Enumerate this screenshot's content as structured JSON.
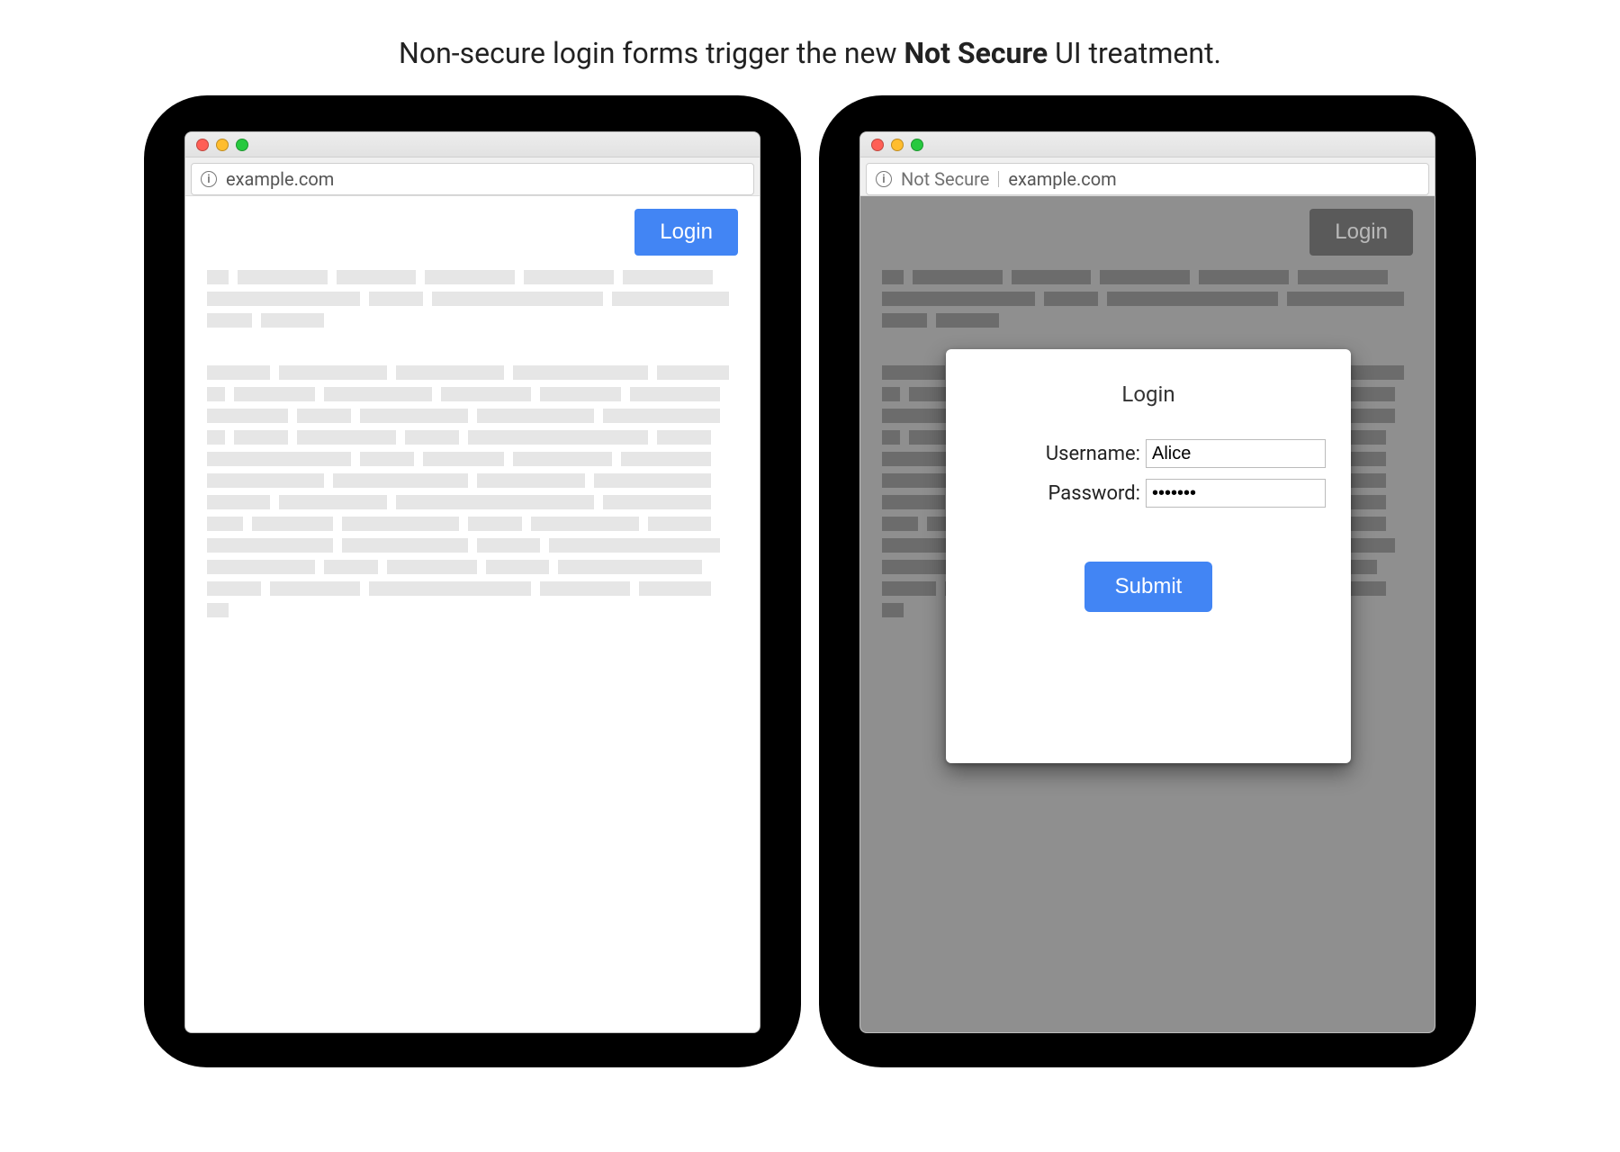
{
  "caption": {
    "prefix": "Non-secure login forms trigger the new ",
    "bold": "Not Secure",
    "suffix": " UI treatment."
  },
  "left_browser": {
    "address": "example.com",
    "login_button": "Login"
  },
  "right_browser": {
    "not_secure_label": "Not Secure",
    "address": "example.com",
    "login_button": "Login",
    "modal": {
      "title": "Login",
      "username_label": "Username:",
      "username_value": "Alice",
      "password_label": "Password:",
      "password_value": "•••••••",
      "submit_label": "Submit"
    }
  }
}
